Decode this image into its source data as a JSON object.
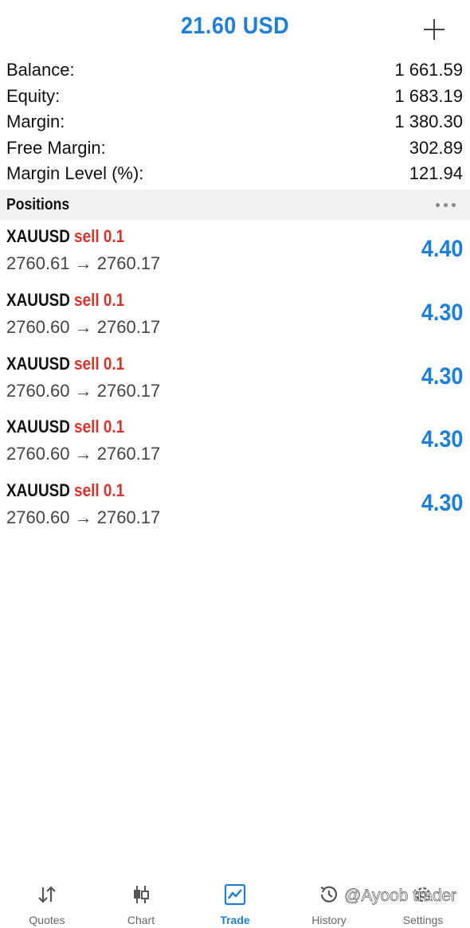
{
  "header": {
    "title": "21.60 USD"
  },
  "account": {
    "rows": [
      {
        "label": "Balance:",
        "value": "1 661.59"
      },
      {
        "label": "Equity:",
        "value": "1 683.19"
      },
      {
        "label": "Margin:",
        "value": "1 380.30"
      },
      {
        "label": "Free Margin:",
        "value": "302.89"
      },
      {
        "label": "Margin Level (%):",
        "value": "121.94"
      }
    ]
  },
  "positions": {
    "title": "Positions",
    "items": [
      {
        "symbol": "XAUUSD",
        "side": "sell 0.1",
        "prices": "2760.61 → 2760.17",
        "profit": "4.40"
      },
      {
        "symbol": "XAUUSD",
        "side": "sell 0.1",
        "prices": "2760.60 → 2760.17",
        "profit": "4.30"
      },
      {
        "symbol": "XAUUSD",
        "side": "sell 0.1",
        "prices": "2760.60 → 2760.17",
        "profit": "4.30"
      },
      {
        "symbol": "XAUUSD",
        "side": "sell 0.1",
        "prices": "2760.60 → 2760.17",
        "profit": "4.30"
      },
      {
        "symbol": "XAUUSD",
        "side": "sell 0.1",
        "prices": "2760.60 → 2760.17",
        "profit": "4.30"
      }
    ]
  },
  "tabs": [
    {
      "label": "Quotes",
      "icon": "quotes-arrows-icon"
    },
    {
      "label": "Chart",
      "icon": "candlestick-chart-icon"
    },
    {
      "label": "Trade",
      "icon": "trade-chart-icon",
      "active": true
    },
    {
      "label": "History",
      "icon": "history-clock-icon"
    },
    {
      "label": "Settings",
      "icon": "gear-icon"
    }
  ],
  "watermark": "@Ayoob trader",
  "colors": {
    "accent": "#1e7fd8",
    "sell": "#d8342a",
    "section_bg": "#f2f2f4"
  }
}
